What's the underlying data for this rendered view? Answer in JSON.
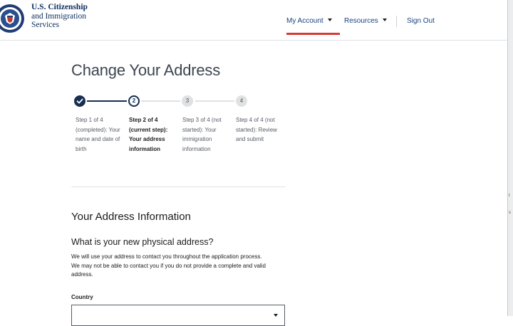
{
  "header": {
    "agency_line1": "U.S. Citizenship",
    "agency_line2": "and Immigration",
    "agency_line3": "Services",
    "seal_icon": "dhs-seal-icon"
  },
  "nav": {
    "my_account": "My Account",
    "resources": "Resources",
    "sign_out": "Sign Out",
    "active": "My Account",
    "accent_color": "#d83933"
  },
  "page": {
    "title": "Change Your Address"
  },
  "stepper": {
    "steps": [
      {
        "number": "1",
        "status": "completed",
        "label": "Step 1 of 4 (completed): Your name and date of birth"
      },
      {
        "number": "2",
        "status": "current",
        "label": "Step 2 of 4 (current step): Your address information"
      },
      {
        "number": "3",
        "status": "not-started",
        "label": "Step 3 of 4 (not started): Your immigration information"
      },
      {
        "number": "4",
        "status": "not-started",
        "label": "Step 4 of 4 (not started): Review and submit"
      }
    ],
    "complete_color": "#162e51",
    "incomplete_color": "#dfe1e2"
  },
  "section": {
    "title": "Your Address Information",
    "question": "What is your new physical address?",
    "help": "We will use your address to contact you throughout the application process. We may not be able to contact you if you do not provide a complete and valid address."
  },
  "form": {
    "country_label": "Country",
    "country_value": ""
  },
  "edge_marks": {
    "mark1": "t",
    "mark2": "s"
  }
}
